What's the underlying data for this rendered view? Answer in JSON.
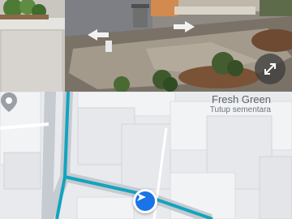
{
  "street_view": {
    "navigation_arrows": [
      "arrow-left-icon",
      "arrow-right-icon"
    ],
    "expand_icon": "expand-icon"
  },
  "map": {
    "place": {
      "name": "Fresh Green",
      "status": "Tutup sementara"
    },
    "route_color": "#12a4bd",
    "location_marker_color": "#1a73e8"
  }
}
